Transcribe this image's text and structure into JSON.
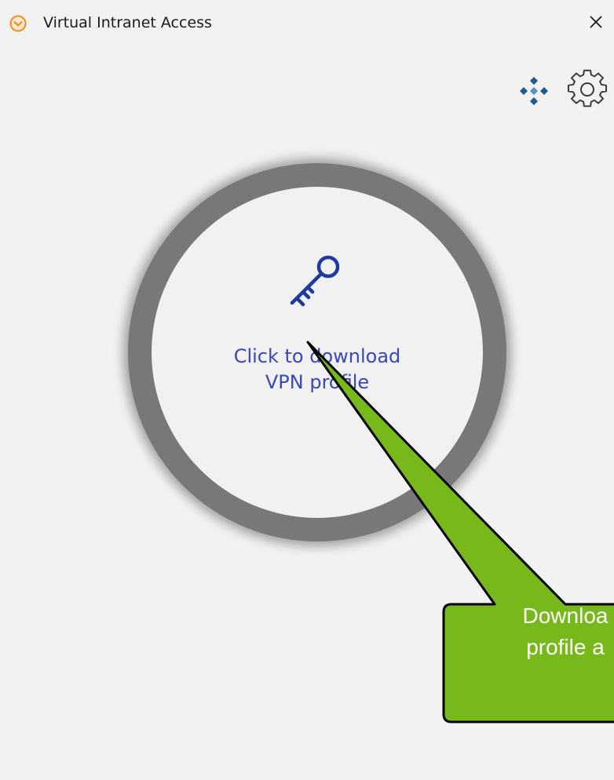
{
  "window": {
    "title": "Virtual Intranet Access",
    "app_icon": "chevron-circle-icon",
    "close_icon": "close-icon",
    "close_glyph": "✕"
  },
  "toolbar": {
    "network_icon": "network-diamond-icon",
    "settings_icon": "gear-icon"
  },
  "main": {
    "key_icon": "key-icon",
    "prompt_line1": "Click to download",
    "prompt_line2": "VPN profile"
  },
  "callout": {
    "line1": "Downloa",
    "line2": "profile a"
  },
  "colors": {
    "accent_orange": "#f08a1c",
    "prompt_blue": "#3848b8",
    "key_blue": "#1e3aa0",
    "ring_gray": "#787878",
    "callout_green": "#77b81b",
    "toolbar_blue": "#1f5c8f"
  }
}
